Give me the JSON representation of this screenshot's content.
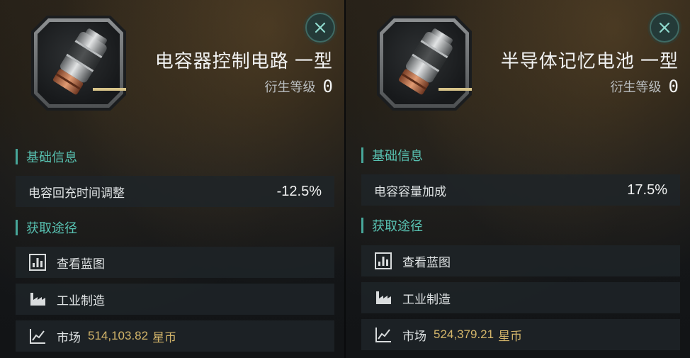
{
  "colors": {
    "accent_teal": "#58c2b2",
    "price_gold": "#d3b56a",
    "rarity_bar": "#d8c48a"
  },
  "panels": [
    {
      "item_name": "电容器控制电路 一型",
      "tier_label": "衍生等级",
      "tier_value": "0",
      "icon": "capacitor-module-icon",
      "close_icon": "close-icon",
      "basic_info_title": "基础信息",
      "stat_name": "电容回充时间调整",
      "stat_value": "-12.5%",
      "acquire_title": "获取途径",
      "sources": {
        "blueprint_label": "查看蓝图",
        "blueprint_icon": "blueprint-icon",
        "industry_label": "工业制造",
        "industry_icon": "factory-icon",
        "market_label": "市场",
        "market_icon": "chart-line-icon",
        "market_price": "514,103.82",
        "currency": "星币"
      }
    },
    {
      "item_name": "半导体记忆电池 一型",
      "tier_label": "衍生等级",
      "tier_value": "0",
      "icon": "capacitor-module-icon",
      "close_icon": "close-icon",
      "basic_info_title": "基础信息",
      "stat_name": "电容容量加成",
      "stat_value": "17.5%",
      "acquire_title": "获取途径",
      "sources": {
        "blueprint_label": "查看蓝图",
        "blueprint_icon": "blueprint-icon",
        "industry_label": "工业制造",
        "industry_icon": "factory-icon",
        "market_label": "市场",
        "market_icon": "chart-line-icon",
        "market_price": "524,379.21",
        "currency": "星币"
      }
    }
  ]
}
